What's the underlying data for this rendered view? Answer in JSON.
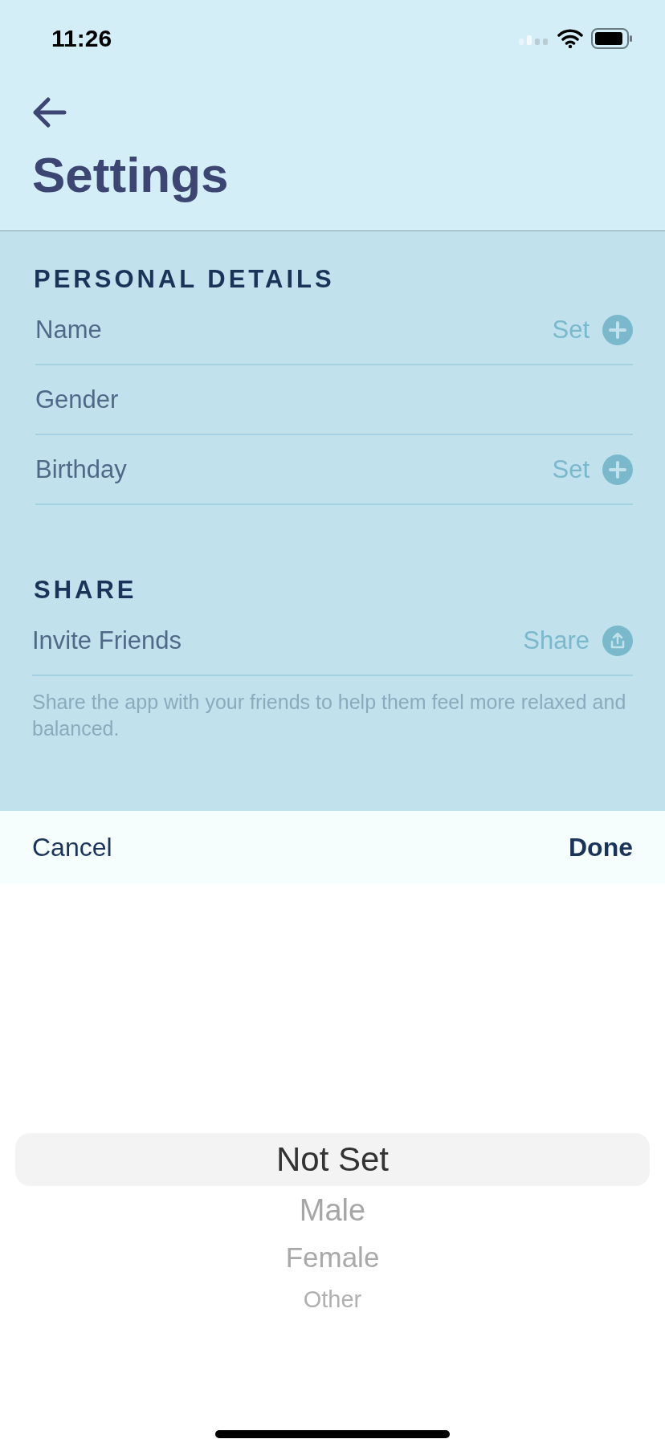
{
  "status_bar": {
    "time": "11:26"
  },
  "header": {
    "title": "Settings"
  },
  "sections": [
    {
      "title": "PERSONAL DETAILS",
      "rows": [
        {
          "label": "Name",
          "kind": "set",
          "action": "Set"
        },
        {
          "label": "Gender",
          "kind": "plain"
        },
        {
          "label": "Birthday",
          "kind": "set",
          "action": "Set"
        }
      ]
    },
    {
      "title": "SHARE",
      "rows": [
        {
          "label": "Invite Friends",
          "kind": "share",
          "action": "Share"
        }
      ],
      "footer": "Share the app with your friends to help them feel more relaxed and balanced."
    }
  ],
  "picker_toolbar": {
    "cancel": "Cancel",
    "done": "Done"
  },
  "picker": {
    "options": [
      {
        "label": "Not Set",
        "selected": true
      },
      {
        "label": "Male",
        "selected": false
      },
      {
        "label": "Female",
        "selected": false
      },
      {
        "label": "Other",
        "selected": false
      }
    ]
  }
}
